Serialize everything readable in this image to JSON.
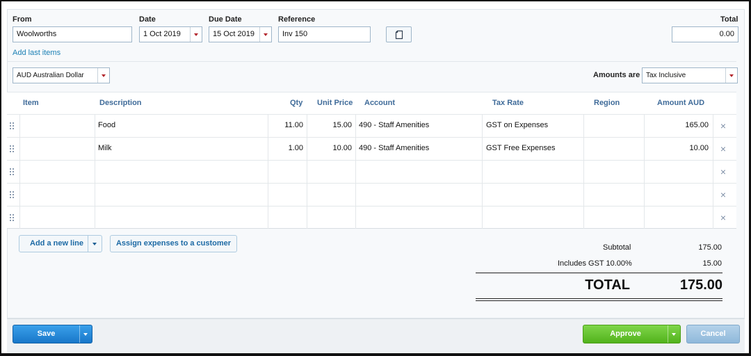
{
  "header": {
    "from_label": "From",
    "from_value": "Woolworths",
    "date_label": "Date",
    "date_value": "1 Oct 2019",
    "due_label": "Due Date",
    "due_value": "15 Oct 2019",
    "reference_label": "Reference",
    "reference_value": "Inv 150",
    "total_label": "Total",
    "total_value": "0.00",
    "add_last_items": "Add last items",
    "currency": "AUD Australian Dollar",
    "amounts_are_label": "Amounts are",
    "amounts_are_value": "Tax Inclusive"
  },
  "table": {
    "columns": [
      "Item",
      "Description",
      "Qty",
      "Unit Price",
      "Account",
      "Tax Rate",
      "Region",
      "Amount AUD"
    ],
    "rows": [
      {
        "item": "",
        "description": "Food",
        "qty": "11.00",
        "unit_price": "15.00",
        "account": "490 - Staff Amenities",
        "tax_rate": "GST on Expenses",
        "region": "",
        "amount": "165.00"
      },
      {
        "item": "",
        "description": "Milk",
        "qty": "1.00",
        "unit_price": "10.00",
        "account": "490 - Staff Amenities",
        "tax_rate": "GST Free Expenses",
        "region": "",
        "amount": "10.00"
      },
      {
        "item": "",
        "description": "",
        "qty": "",
        "unit_price": "",
        "account": "",
        "tax_rate": "",
        "region": "",
        "amount": ""
      },
      {
        "item": "",
        "description": "",
        "qty": "",
        "unit_price": "",
        "account": "",
        "tax_rate": "",
        "region": "",
        "amount": ""
      },
      {
        "item": "",
        "description": "",
        "qty": "",
        "unit_price": "",
        "account": "",
        "tax_rate": "",
        "region": "",
        "amount": ""
      }
    ]
  },
  "actions": {
    "add_new_line": "Add a new line",
    "assign_expenses": "Assign expenses to a customer"
  },
  "totals": {
    "subtotal_label": "Subtotal",
    "subtotal_value": "175.00",
    "gst_label": "Includes GST 10.00%",
    "gst_value": "15.00",
    "total_label": "TOTAL",
    "total_value": "175.00"
  },
  "footer": {
    "save": "Save",
    "approve": "Approve",
    "cancel": "Cancel"
  },
  "colors": {
    "header_text": "#3f6b99",
    "link": "#1a7fb4",
    "save_blue": "#1877c9",
    "approve_green": "#52b21c",
    "cancel_blue": "#8fb8da",
    "dropdown_caret": "#b3262d"
  },
  "icons": {
    "copy": "copy-icon",
    "drag": "drag-handle-icon",
    "delete": "close-icon"
  }
}
